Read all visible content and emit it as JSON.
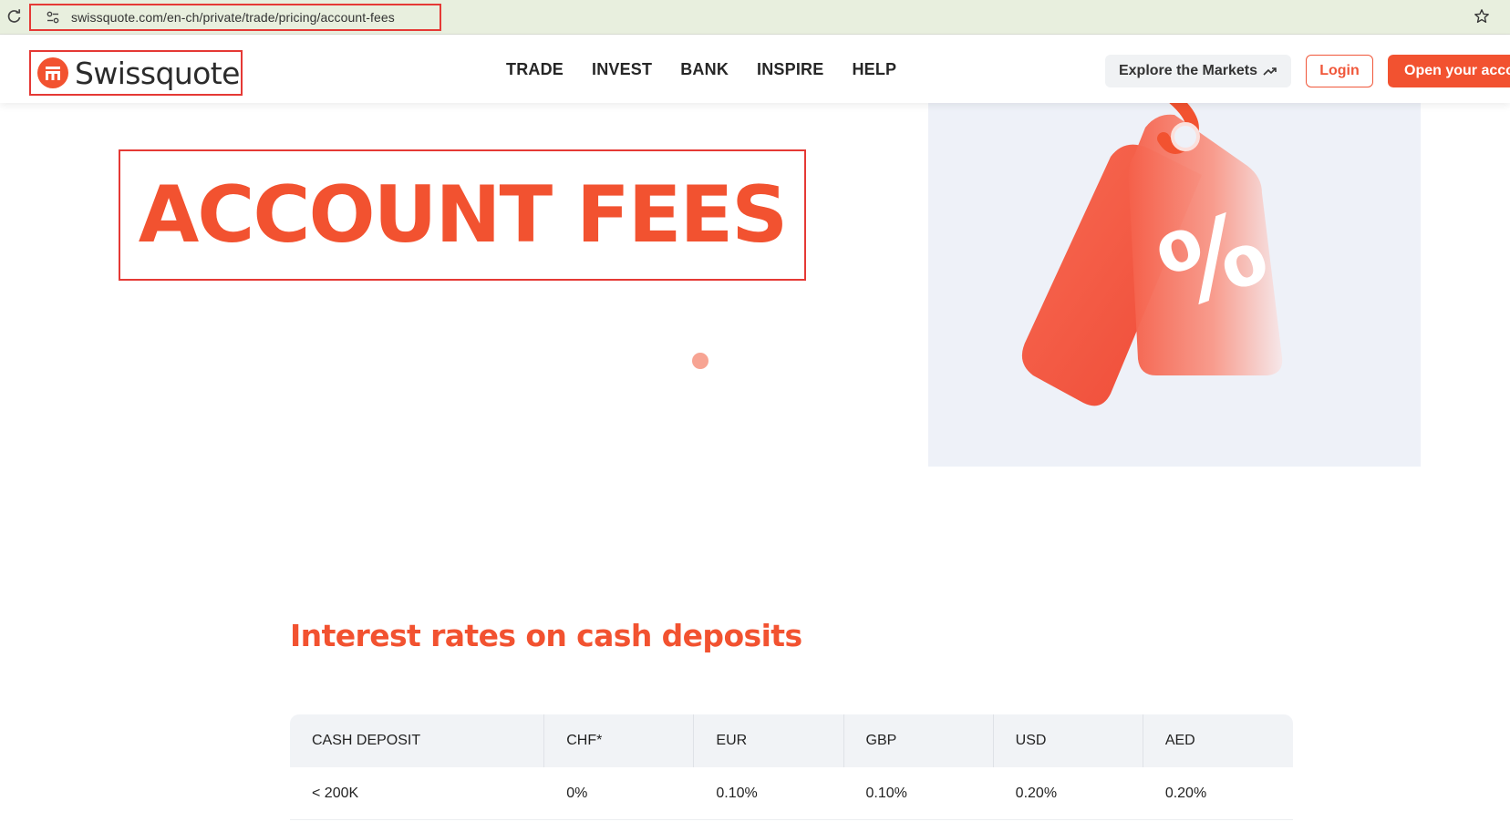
{
  "browser": {
    "url": "swissquote.com/en-ch/private/trade/pricing/account-fees"
  },
  "header": {
    "logo_text": "Swissquote",
    "nav": [
      "TRADE",
      "INVEST",
      "BANK",
      "INSPIRE",
      "HELP"
    ],
    "explore_label": "Explore the Markets",
    "login_label": "Login",
    "open_account_label": "Open your acco"
  },
  "hero": {
    "title": "ACCOUNT FEES",
    "image_symbol": "%"
  },
  "section": {
    "title": "Interest rates on cash deposits"
  },
  "table": {
    "headers": [
      "CASH DEPOSIT",
      "CHF*",
      "EUR",
      "GBP",
      "USD",
      "AED"
    ],
    "rows": [
      [
        "< 200K",
        "0%",
        "0.10%",
        "0.10%",
        "0.20%",
        "0.20%"
      ]
    ]
  },
  "colors": {
    "brand": "#f25230",
    "hero_bg": "#eef1f8",
    "browser_bar": "#e8efde"
  }
}
